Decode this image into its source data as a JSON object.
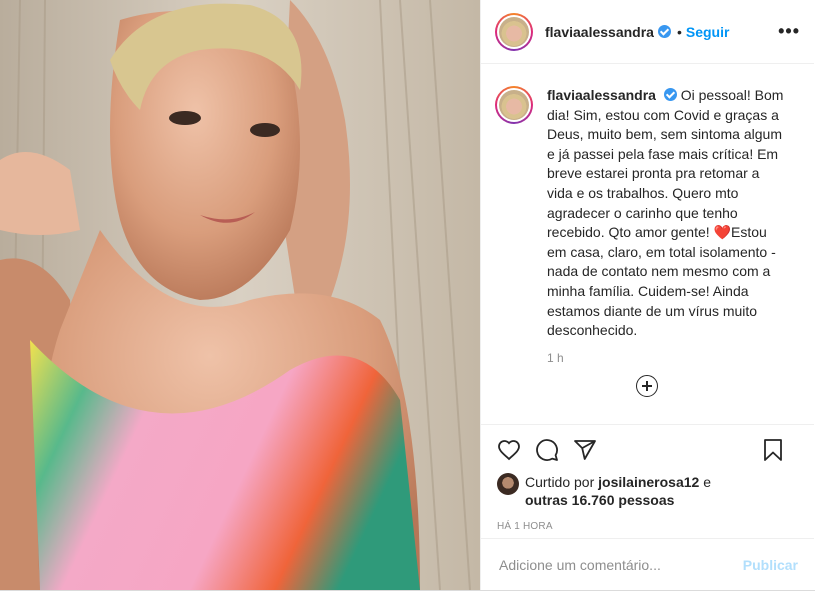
{
  "post": {
    "username": "flaviaalessandra",
    "follow_label": "Seguir",
    "dot": "•",
    "more_label": "•••"
  },
  "caption": {
    "username": "flaviaalessandra",
    "text_before_emoji": "Oi pessoal! Bom dia! Sim, estou com Covid e graças a Deus, muito bem, sem sintoma algum e já passei pela fase mais crítica! Em breve estarei pronta pra retomar a vida e os trabalhos. Quero mto agradecer o carinho que tenho recebido. Qto amor gente! ",
    "emoji": "❤️",
    "text_after_emoji": "Estou em casa, claro, em total isolamento - nada de contato nem mesmo com a minha família. Cuidem-se! Ainda estamos diante de um vírus muito desconhecido.",
    "time": "1 h"
  },
  "likes": {
    "prefix": "Curtido por ",
    "user": "josilainerosa12",
    "middle": " e",
    "others": "outras 16.760 pessoas"
  },
  "timestamp": "HÁ 1 HORA",
  "comment": {
    "placeholder": "Adicione um comentário...",
    "publish_label": "Publicar"
  },
  "colors": {
    "accent": "#0095f6",
    "verified": "#3897f0",
    "publish_disabled": "#b2dffc"
  },
  "icons": [
    "verified-badge-icon",
    "more-options-icon",
    "add-circle-icon",
    "heart-icon",
    "comment-icon",
    "share-icon",
    "bookmark-icon"
  ]
}
